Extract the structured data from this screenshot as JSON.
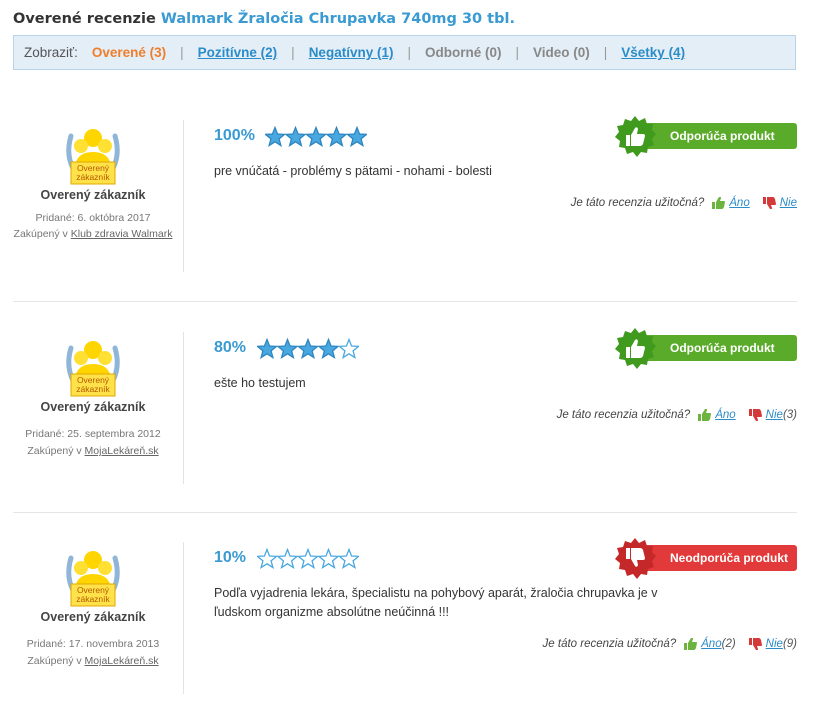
{
  "page": {
    "title_prefix": "Overené recenzie",
    "product_name": "Walmark Žraločia Chrupavka 740mg 30 tbl."
  },
  "filters": {
    "label": "Zobraziť:",
    "items": [
      {
        "label": "Overené (3)",
        "state": "active"
      },
      {
        "label": "Pozitívne (2)",
        "state": "link"
      },
      {
        "label": "Negatívny (1)",
        "state": "link"
      },
      {
        "label": "Odborné (0)",
        "state": "disabled"
      },
      {
        "label": "Video (0)",
        "state": "disabled"
      },
      {
        "label": "Všetky (4)",
        "state": "link"
      }
    ]
  },
  "common": {
    "medal_text_line1": "Overený",
    "medal_text_line2": "zákazník",
    "helpful_question": "Je táto recenzia užitočná?",
    "yes_label": "Áno",
    "no_label": "Nie",
    "colors": {
      "accent": "#3a9ad2",
      "active_filter": "#f07d2a",
      "recommend": "#5bab2a",
      "not_recommend": "#e23a3a",
      "star": "#4aa8e0"
    }
  },
  "reviews": [
    {
      "rating_text": "100%",
      "stars_filled": 5,
      "stars_total": 5,
      "text": "pre vnúčatá - problémy s pätami - nohami - bolesti",
      "verdict": "Odporúča produkt",
      "verdict_type": "recommend",
      "user_name": "Overený zákazník",
      "added": "Pridané: 6. októbra 2017",
      "bought_prefix": "Zakúpený v",
      "shop": "Klub zdravia Walmark",
      "yes_count": "",
      "no_count": ""
    },
    {
      "rating_text": "80%",
      "stars_filled": 4,
      "stars_total": 5,
      "text": "ešte ho testujem",
      "verdict": "Odporúča produkt",
      "verdict_type": "recommend",
      "user_name": "Overený zákazník",
      "added": "Pridané: 25. septembra 2012",
      "bought_prefix": "Zakúpený v",
      "shop": "MojaLekáreň.sk",
      "yes_count": "",
      "no_count": "(3)"
    },
    {
      "rating_text": "10%",
      "stars_filled": 0,
      "stars_total": 5,
      "text": "Podľa vyjadrenia lekára, špecialistu na pohybový aparát, žraločia chrupavka je v ľudskom organizme absolútne neúčinná !!!",
      "verdict": "Neodporúča produkt",
      "verdict_type": "not_recommend",
      "user_name": "Overený zákazník",
      "added": "Pridané: 17. novembra 2013",
      "bought_prefix": "Zakúpený v",
      "shop": "MojaLekáreň.sk",
      "yes_count": "(2)",
      "no_count": "(9)"
    }
  ]
}
